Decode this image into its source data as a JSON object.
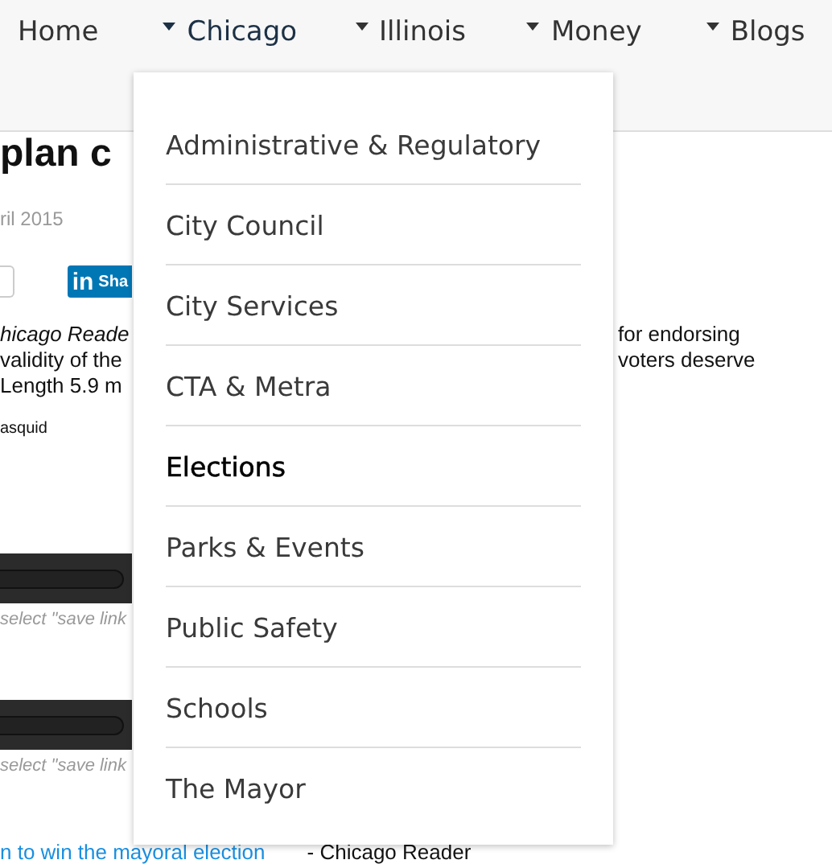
{
  "nav": {
    "items": [
      {
        "label": "Home",
        "kind": "link",
        "selected": false
      },
      {
        "label": "Chicago",
        "kind": "dropdown",
        "selected": true
      },
      {
        "label": "Illinois",
        "kind": "dropdown",
        "selected": false
      },
      {
        "label": "Money",
        "kind": "dropdown",
        "selected": false
      },
      {
        "label": "Blogs",
        "kind": "dropdown",
        "selected": false
      }
    ]
  },
  "dropdown": {
    "items": [
      {
        "label": "Administrative & Regulatory",
        "selected": false
      },
      {
        "label": "City Council",
        "selected": false
      },
      {
        "label": "City Services",
        "selected": false
      },
      {
        "label": "CTA & Metra",
        "selected": false
      },
      {
        "label": "Elections",
        "selected": true
      },
      {
        "label": "Parks & Events",
        "selected": false
      },
      {
        "label": "Public Safety",
        "selected": false
      },
      {
        "label": "Schools",
        "selected": false
      },
      {
        "label": "The Mayor",
        "selected": false
      }
    ]
  },
  "article": {
    "title": "plan c",
    "date": "ril 2015",
    "share_button": "Sha",
    "share_icon": "in",
    "lead": [
      {
        "left": "hicago Reade",
        "left_italic": true,
        "right": "for endorsing"
      },
      {
        "left": "validity of the",
        "left_italic": false,
        "right": "voters deserve"
      },
      {
        "left": "Length 5.9 m",
        "left_italic": false
      }
    ],
    "credit": "asquid",
    "players": [
      {
        "caption": "select \"save link"
      },
      {
        "caption": "select \"save link"
      }
    ],
    "footer": {
      "link": "n to win the mayoral election",
      "source": "- Chicago Reader"
    }
  }
}
